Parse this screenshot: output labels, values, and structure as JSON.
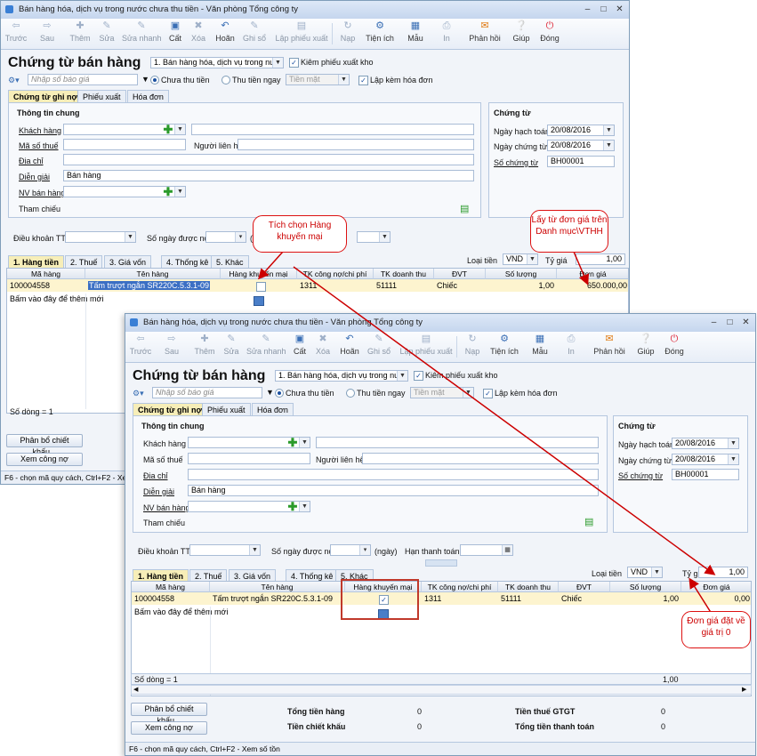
{
  "window": {
    "title": "Bán hàng hóa, dịch vụ trong nước chưa thu tiền - Văn phòng Tổng công ty"
  },
  "toolbar": [
    {
      "label": "Trước",
      "icon": "arrow-left-icon",
      "enabled": false
    },
    {
      "label": "Sau",
      "icon": "arrow-right-icon",
      "enabled": false
    },
    {
      "label": "Thêm",
      "icon": "add-icon",
      "enabled": false
    },
    {
      "label": "Sửa",
      "icon": "edit-icon",
      "enabled": false
    },
    {
      "label": "Sửa nhanh",
      "icon": "quick-edit-icon",
      "enabled": false
    },
    {
      "label": "Cất",
      "icon": "save-icon",
      "enabled": true
    },
    {
      "label": "Xóa",
      "icon": "delete-icon",
      "enabled": false
    },
    {
      "label": "Hoãn",
      "icon": "undo-icon",
      "enabled": true
    },
    {
      "label": "Ghi sổ",
      "icon": "post-icon",
      "enabled": false
    },
    {
      "label": "Lập phiếu xuất",
      "icon": "issue-voucher-icon",
      "enabled": false
    },
    {
      "label": "Nạp",
      "icon": "reload-icon",
      "enabled": false
    },
    {
      "label": "Tiện ích",
      "icon": "utilities-icon",
      "enabled": true
    },
    {
      "label": "Mẫu",
      "icon": "template-icon",
      "enabled": true
    },
    {
      "label": "In",
      "icon": "print-icon",
      "enabled": false
    },
    {
      "label": "Phản hồi",
      "icon": "mail-icon",
      "enabled": true
    },
    {
      "label": "Giúp",
      "icon": "help-icon",
      "enabled": true
    },
    {
      "label": "Đóng",
      "icon": "close-icon",
      "enabled": true
    }
  ],
  "header": {
    "title": "Chứng từ bán hàng",
    "voucher_type": "1. Bán hàng hóa, dịch vụ trong nước",
    "inventory_check_label": "Kiêm phiếu xuất kho",
    "inventory_checked": true,
    "quote_placeholder": "Nhập số báo giá",
    "unpaid_label": "Chưa thu tiền",
    "paid_label": "Thu tiền ngay",
    "payment_method": "Tiền mặt",
    "with_invoice_label": "Lập kèm hóa đơn",
    "with_invoice_checked": true
  },
  "tabs": [
    "Chứng từ ghi nợ",
    "Phiếu xuất",
    "Hóa đơn"
  ],
  "general": {
    "section_title": "Thông tin chung",
    "customer_label": "Khách hàng",
    "tax_code_label": "Mã số thuế",
    "contact_label": "Người liên hệ",
    "address_label": "Địa chỉ",
    "description_label": "Diễn giải",
    "description_value": "Bán hàng",
    "salesperson_label": "NV bán hàng",
    "reference_label": "Tham chiếu"
  },
  "voucher": {
    "section_title": "Chứng từ",
    "posting_date_label": "Ngày hạch toán",
    "posting_date": "20/08/2016",
    "voucher_date_label": "Ngày chứng từ",
    "voucher_date": "20/08/2016",
    "voucher_no_label": "Số chứng từ",
    "voucher_no": "BH00001"
  },
  "terms": {
    "payment_terms_label": "Điều khoản TT",
    "days_label": "Số ngày được nợ",
    "days_unit": "(ngày)",
    "due_date_label": "Hạn thanh toán"
  },
  "detail_tabs": [
    "1. Hàng tiền",
    "2. Thuế",
    "3. Giá vốn",
    "4. Thống kê",
    "5. Khác"
  ],
  "currency": {
    "label": "Loại tiền",
    "value": "VND",
    "rate_label": "Tỷ giá",
    "rate_value": "1,00"
  },
  "grid": {
    "columns": [
      "Mã hàng",
      "Tên hàng",
      "Hàng khuyến mại",
      "TK công nợ/chi phí",
      "TK doanh thu",
      "ĐVT",
      "Số lượng",
      "Đơn giá"
    ],
    "row": {
      "code": "100004558",
      "name": "Tấm trượt ngắn SR220C.5.3.1-09",
      "promo": true,
      "debit_account": "1311",
      "revenue_account": "51111",
      "unit": "Chiếc",
      "quantity": "1,00",
      "price_before": "650.000,00",
      "price_after": "0,00"
    },
    "add_row_hint": "Bấm vào đây để thêm mới",
    "row_count": "Số dòng = 1",
    "total_quantity": "1,00"
  },
  "footer": {
    "allocate_discount_button": "Phân bổ chiết khấu...",
    "view_debt_button": "Xem công nợ",
    "total_goods_label": "Tổng tiền hàng",
    "total_goods_value": "0",
    "total_discount_label": "Tiền chiết khấu",
    "total_discount_value": "0",
    "vat_label": "Tiền thuế GTGT",
    "vat_value": "0",
    "total_payment_label": "Tổng tiền thanh toán",
    "total_payment_value": "0",
    "status_text": "F6 - chọn mã quy cách, Ctrl+F2 - Xem số tồn",
    "status_text_short": "F6 - chọn mã quy cách, Ctrl+F2 - Xem"
  },
  "annotations": {
    "promo_callout": "Tích chọn Hàng khuyến mại",
    "price_callout": "Lấy từ đơn giá trên Danh mục\\VTHH",
    "zero_callout": "Đơn giá đặt về giá trị 0"
  },
  "colors": {
    "callout_red": "#cc0000",
    "tab_active": "#f7eeb8",
    "window_bg": "#f1f4f9"
  }
}
